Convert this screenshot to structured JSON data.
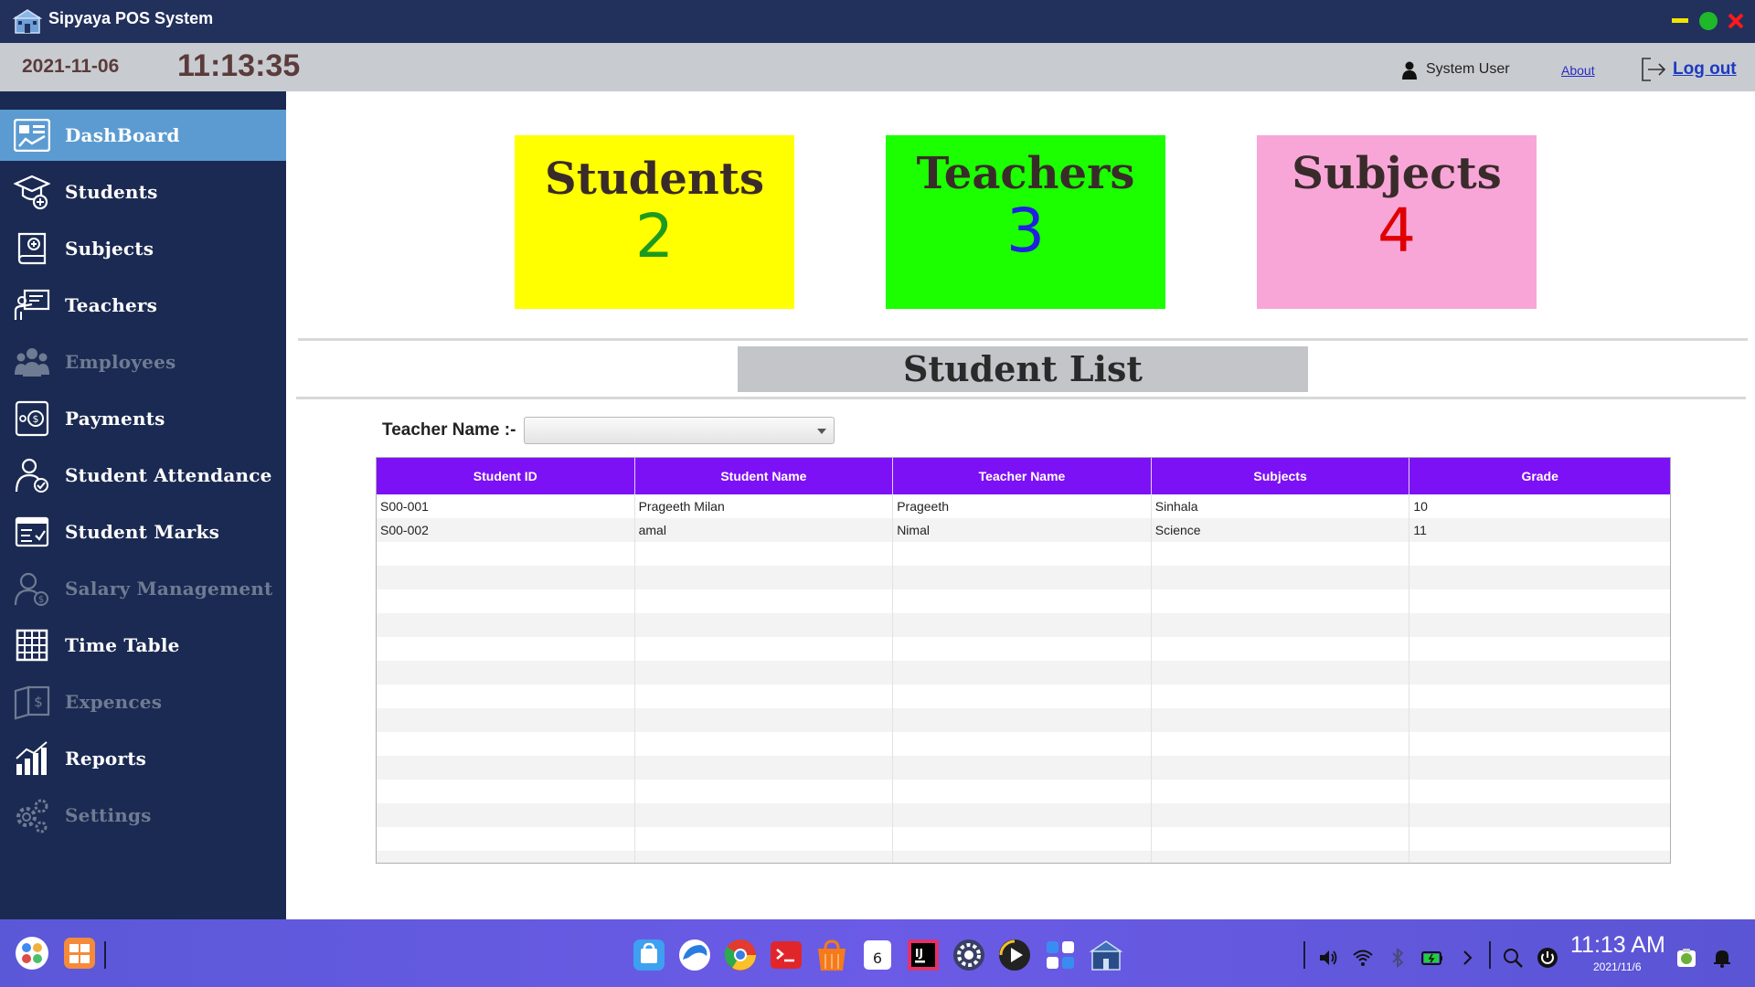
{
  "window": {
    "title": "Sipyaya POS System"
  },
  "header": {
    "date": "2021-11-06",
    "time": "11:13:35",
    "user": "System User",
    "about": "About",
    "logout": "Log out"
  },
  "sidebar": {
    "items": [
      {
        "label": "DashBoard",
        "icon": "dashboard-icon",
        "active": true,
        "enabled": true
      },
      {
        "label": "Students",
        "icon": "student-cap-icon",
        "enabled": true
      },
      {
        "label": "Subjects",
        "icon": "book-icon",
        "enabled": true
      },
      {
        "label": "Teachers",
        "icon": "teacher-board-icon",
        "enabled": true
      },
      {
        "label": "Employees",
        "icon": "employees-icon",
        "enabled": false
      },
      {
        "label": "Payments",
        "icon": "payments-icon",
        "enabled": true
      },
      {
        "label": "Student Attendance",
        "icon": "attendance-icon",
        "enabled": true
      },
      {
        "label": "Student Marks",
        "icon": "marks-icon",
        "enabled": true
      },
      {
        "label": "Salary Management",
        "icon": "salary-icon",
        "enabled": false
      },
      {
        "label": "Time Table",
        "icon": "grid-icon",
        "enabled": true
      },
      {
        "label": "Expences",
        "icon": "expenses-icon",
        "enabled": false
      },
      {
        "label": "Reports",
        "icon": "bar-chart-icon",
        "enabled": true
      },
      {
        "label": "Settings",
        "icon": "gear-icon",
        "enabled": false
      }
    ]
  },
  "cards": [
    {
      "title": "Students",
      "value": "2",
      "bg": "#ffff00",
      "value_color": "#1e9a1e"
    },
    {
      "title": "Teachers",
      "value": "3",
      "bg": "#1cff00",
      "value_color": "#2020e0"
    },
    {
      "title": "Subjects",
      "value": "4",
      "bg": "#f8a6d8",
      "value_color": "#e00000"
    }
  ],
  "student_list": {
    "title": "Student List",
    "filter_label": "Teacher Name :-",
    "filter_value": "",
    "columns": [
      "Student ID",
      "Student Name",
      "Teacher Name",
      "Subjects",
      "Grade"
    ],
    "rows": [
      [
        "S00-001",
        "Prageeth Milan",
        "Prageeth",
        "Sinhala",
        "10"
      ],
      [
        "S00-002",
        "amal",
        "Nimal",
        "Science",
        "11"
      ]
    ]
  },
  "taskbar": {
    "clock": "11:13 AM",
    "date": "2021/11/6",
    "calendar_day": "6"
  },
  "colors": {
    "titlebar": "#22305c",
    "sidebar": "#1b2a52",
    "active_nav": "#5b9bd1",
    "table_header": "#7d11f5",
    "taskbar": "#5b58d8"
  }
}
